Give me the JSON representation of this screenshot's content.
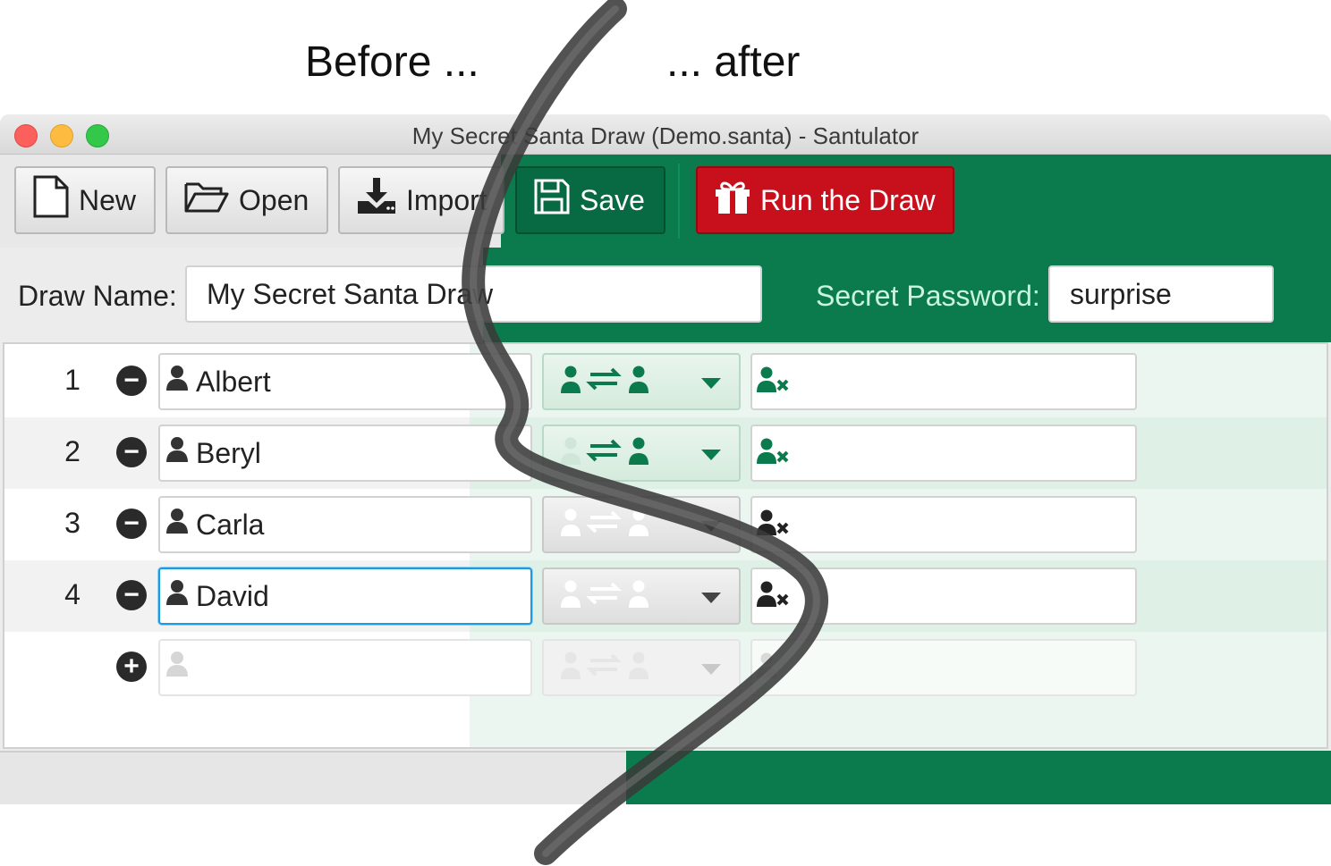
{
  "captions": {
    "before": "Before ...",
    "after": "... after"
  },
  "window": {
    "title": "My Secret Santa Draw (Demo.santa) - Santulator"
  },
  "toolbar": {
    "new_label": "New",
    "open_label": "Open",
    "import_label": "Import",
    "save_label": "Save",
    "run_label": "Run the Draw"
  },
  "form": {
    "draw_name_label": "Draw Name:",
    "draw_name_value": "My Secret Santa Draw",
    "password_label": "Secret Password:",
    "password_value": "surprise"
  },
  "participants": [
    {
      "number": "1",
      "name": "Albert"
    },
    {
      "number": "2",
      "name": "Beryl"
    },
    {
      "number": "3",
      "name": "Carla"
    },
    {
      "number": "4",
      "name": "David"
    }
  ],
  "colors": {
    "accent_green": "#0b7a4d",
    "run_red": "#c8101c",
    "focus_blue": "#1a9be6"
  },
  "icons": [
    "new-file-icon",
    "open-folder-icon",
    "import-icon",
    "save-icon",
    "gift-icon",
    "remove-icon",
    "add-icon",
    "person-icon",
    "swap-icon",
    "person-exclude-icon"
  ]
}
